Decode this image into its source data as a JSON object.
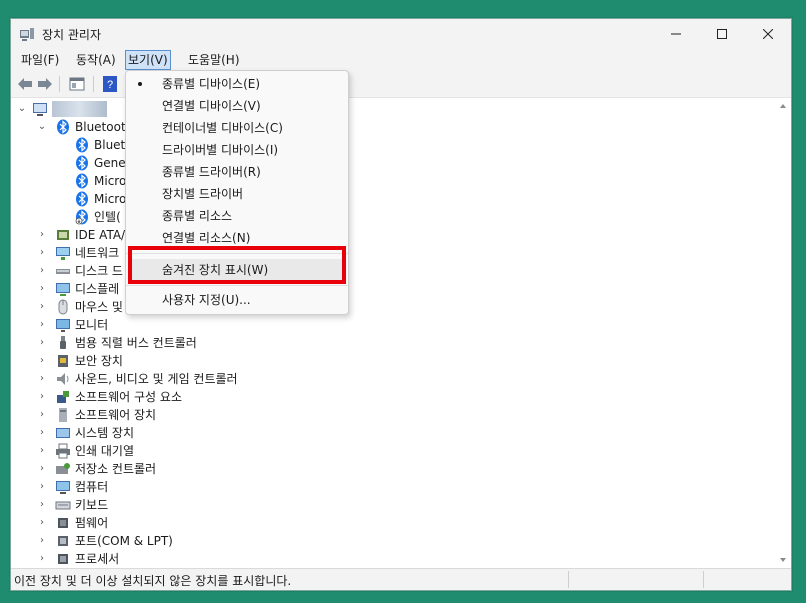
{
  "window": {
    "title": "장치 관리자"
  },
  "titlebar_buttons": {
    "minimize": "—",
    "maximize": "☐",
    "close": "✕"
  },
  "menubar": {
    "items": [
      {
        "label": "파일(F)"
      },
      {
        "label": "동작(A)"
      },
      {
        "label": "보기(V)"
      },
      {
        "label": "도움말(H)"
      }
    ]
  },
  "tree": {
    "root": {
      "label": ""
    },
    "bluetooth": {
      "label": "Bluetooth",
      "children": [
        {
          "label": "Blueto"
        },
        {
          "label": "Gener"
        },
        {
          "label": "Micro"
        },
        {
          "label": "Micro"
        },
        {
          "label": "인텔("
        }
      ]
    },
    "categories": [
      {
        "label": "IDE ATA/",
        "icon": "ide-icon"
      },
      {
        "label": "네트워크",
        "icon": "network-icon"
      },
      {
        "label": "디스크 드",
        "icon": "disk-icon"
      },
      {
        "label": "디스플레",
        "icon": "display-icon"
      },
      {
        "label": "마우스 및",
        "icon": "mouse-icon"
      },
      {
        "label": "모니터",
        "icon": "monitor-icon"
      },
      {
        "label": "범용 직렬 버스 컨트롤러",
        "icon": "usb-icon"
      },
      {
        "label": "보안 장치",
        "icon": "security-icon"
      },
      {
        "label": "사운드, 비디오 및 게임 컨트롤러",
        "icon": "speaker-icon"
      },
      {
        "label": "소프트웨어 구성 요소",
        "icon": "component-icon"
      },
      {
        "label": "소프트웨어 장치",
        "icon": "software-device-icon"
      },
      {
        "label": "시스템 장치",
        "icon": "system-icon"
      },
      {
        "label": "인쇄 대기열",
        "icon": "printer-icon"
      },
      {
        "label": "저장소 컨트롤러",
        "icon": "storage-icon"
      },
      {
        "label": "컴퓨터",
        "icon": "computer-icon"
      },
      {
        "label": "키보드",
        "icon": "keyboard-icon"
      },
      {
        "label": "펌웨어",
        "icon": "firmware-icon"
      },
      {
        "label": "포트(COM & LPT)",
        "icon": "port-icon"
      },
      {
        "label": "프로세서",
        "icon": "processor-icon"
      }
    ]
  },
  "view_menu": {
    "items": [
      {
        "label": "종류별 디바이스(E)",
        "checked": true
      },
      {
        "label": "연결별 디바이스(V)"
      },
      {
        "label": "컨테이너별 디바이스(C)"
      },
      {
        "label": "드라이버별 디바이스(I)"
      },
      {
        "label": "종류별 드라이버(R)"
      },
      {
        "label": "장치별 드라이버"
      },
      {
        "label": "종류별 리소스"
      },
      {
        "label": "연결별 리소스(N)"
      },
      {
        "label": "숨겨진 장치 표시(W)",
        "highlighted": true
      },
      {
        "label": "사용자 지정(U)..."
      }
    ]
  },
  "statusbar": {
    "text": "이전 장치 및 더 이상 설치되지 않은 장치를 표시합니다."
  },
  "colors": {
    "desktop": "#1f8c70",
    "highlight_box": "#e8000b",
    "bluetooth": "#1a73e8"
  }
}
